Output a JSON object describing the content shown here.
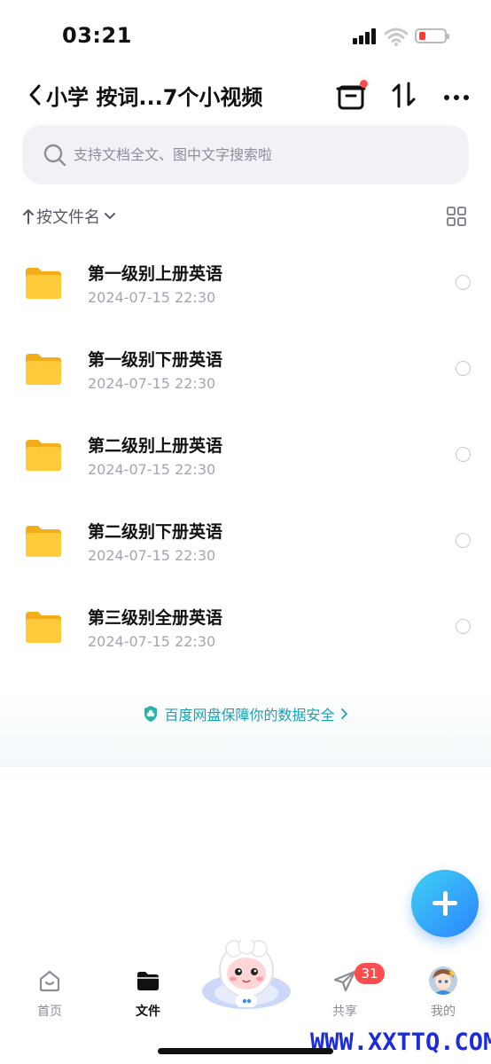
{
  "status_bar": {
    "time": "03:21"
  },
  "nav": {
    "title": "小学 按词...7个小视频"
  },
  "search": {
    "placeholder": "支持文档全文、图中文字搜索啦"
  },
  "sort": {
    "label": "按文件名"
  },
  "files": [
    {
      "name": "第一级别上册英语",
      "date": "2024-07-15 22:30"
    },
    {
      "name": "第一级别下册英语",
      "date": "2024-07-15 22:30"
    },
    {
      "name": "第二级别上册英语",
      "date": "2024-07-15 22:30"
    },
    {
      "name": "第二级别下册英语",
      "date": "2024-07-15 22:30"
    },
    {
      "name": "第三级别全册英语",
      "date": "2024-07-15 22:30"
    }
  ],
  "security_banner": {
    "text": "百度网盘保障你的数据安全"
  },
  "tabs": [
    {
      "label": "首页",
      "icon": "home-icon"
    },
    {
      "label": "文件",
      "icon": "folder-icon"
    },
    {
      "label": "共享",
      "icon": "send-icon"
    },
    {
      "label": "我的",
      "icon": "avatar"
    }
  ],
  "share_badge": "31",
  "watermark": "WWW.XXTTQ.COM",
  "colors": {
    "accent": "#2b84ff",
    "folder": "#ffc933",
    "badge": "#ff4d4f",
    "security_text": "#1b9fb5"
  }
}
